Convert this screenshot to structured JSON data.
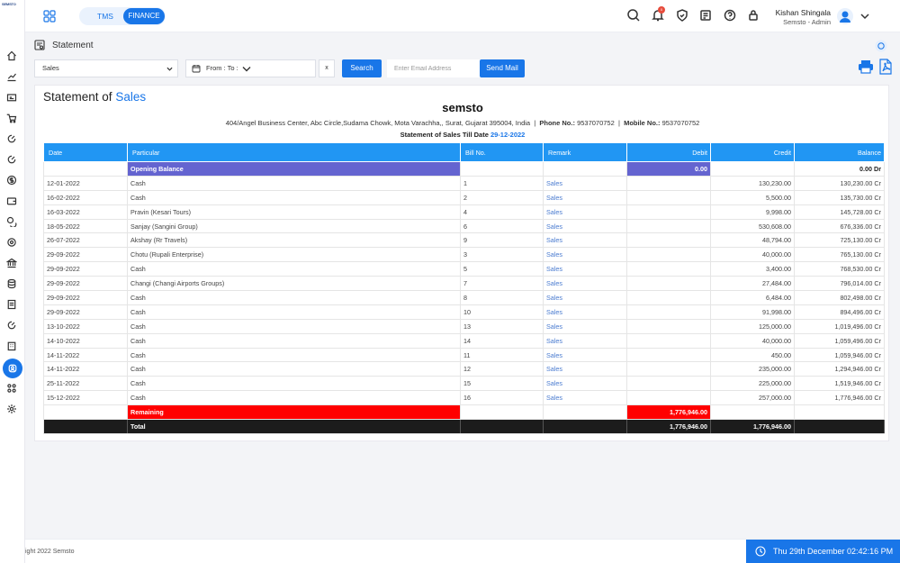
{
  "app": {
    "logo_text": "SEMSTO"
  },
  "header": {
    "tabs": [
      {
        "label": "TMS"
      },
      {
        "label": "FINANCE"
      }
    ],
    "notification_count": "0",
    "user": {
      "name": "Kishan Shingala",
      "role": "Semsto - Admin"
    }
  },
  "page": {
    "title": "Statement"
  },
  "filters": {
    "type_value": "Sales",
    "date_label": "From : To :",
    "clear_label": "x",
    "search_label": "Search",
    "email_placeholder": "Enter Email Address",
    "send_mail_label": "Send Mail"
  },
  "statement": {
    "title_prefix": "Statement of",
    "title_highlight": "Sales",
    "company": "semsto",
    "address": "404/Angel Business Center, Abc Circle,Sudama Chowk, Mota Varachha,, Surat, Gujarat 395004, India",
    "phone_label": "Phone No.:",
    "phone": "9537070752",
    "mobile_label": "Mobile No.:",
    "mobile": "9537070752",
    "till_label": "Statement of Sales Till Date",
    "till_date": "29-12-2022"
  },
  "table": {
    "headers": [
      "Date",
      "Particular",
      "Bill No.",
      "Remark",
      "Debit",
      "Credit",
      "Balance"
    ],
    "opening": {
      "label": "Opening Balance",
      "debit": "0.00",
      "balance": "0.00 Dr"
    },
    "rows": [
      {
        "date": "12-01-2022",
        "particular": "Cash",
        "bill": "1",
        "remark": "Sales",
        "credit": "130,230.00",
        "balance": "130,230.00 Cr"
      },
      {
        "date": "16-02-2022",
        "particular": "Cash",
        "bill": "2",
        "remark": "Sales",
        "credit": "5,500.00",
        "balance": "135,730.00 Cr"
      },
      {
        "date": "16-03-2022",
        "particular": "Pravin (Kesari Tours)",
        "bill": "4",
        "remark": "Sales",
        "credit": "9,998.00",
        "balance": "145,728.00 Cr"
      },
      {
        "date": "18-05-2022",
        "particular": "Sanjay (Sangini Group)",
        "bill": "6",
        "remark": "Sales",
        "credit": "530,608.00",
        "balance": "676,336.00 Cr"
      },
      {
        "date": "26-07-2022",
        "particular": "Akshay (Rr Travels)",
        "bill": "9",
        "remark": "Sales",
        "credit": "48,794.00",
        "balance": "725,130.00 Cr"
      },
      {
        "date": "29-09-2022",
        "particular": "Chotu (Rupali Enterprise)",
        "bill": "3",
        "remark": "Sales",
        "credit": "40,000.00",
        "balance": "765,130.00 Cr"
      },
      {
        "date": "29-09-2022",
        "particular": "Cash",
        "bill": "5",
        "remark": "Sales",
        "credit": "3,400.00",
        "balance": "768,530.00 Cr"
      },
      {
        "date": "29-09-2022",
        "particular": "Changi (Changi Airports Groups)",
        "bill": "7",
        "remark": "Sales",
        "credit": "27,484.00",
        "balance": "796,014.00 Cr"
      },
      {
        "date": "29-09-2022",
        "particular": "Cash",
        "bill": "8",
        "remark": "Sales",
        "credit": "6,484.00",
        "balance": "802,498.00 Cr"
      },
      {
        "date": "29-09-2022",
        "particular": "Cash",
        "bill": "10",
        "remark": "Sales",
        "credit": "91,998.00",
        "balance": "894,496.00 Cr"
      },
      {
        "date": "13-10-2022",
        "particular": "Cash",
        "bill": "13",
        "remark": "Sales",
        "credit": "125,000.00",
        "balance": "1,019,496.00 Cr"
      },
      {
        "date": "14-10-2022",
        "particular": "Cash",
        "bill": "14",
        "remark": "Sales",
        "credit": "40,000.00",
        "balance": "1,059,496.00 Cr"
      },
      {
        "date": "14-11-2022",
        "particular": "Cash",
        "bill": "11",
        "remark": "Sales",
        "credit": "450.00",
        "balance": "1,059,946.00 Cr"
      },
      {
        "date": "14-11-2022",
        "particular": "Cash",
        "bill": "12",
        "remark": "Sales",
        "credit": "235,000.00",
        "balance": "1,294,946.00 Cr"
      },
      {
        "date": "25-11-2022",
        "particular": "Cash",
        "bill": "15",
        "remark": "Sales",
        "credit": "225,000.00",
        "balance": "1,519,946.00 Cr"
      },
      {
        "date": "15-12-2022",
        "particular": "Cash",
        "bill": "16",
        "remark": "Sales",
        "credit": "257,000.00",
        "balance": "1,776,946.00 Cr"
      }
    ],
    "remaining": {
      "label": "Remaining",
      "debit": "1,776,946.00"
    },
    "total": {
      "label": "Total",
      "debit": "1,776,946.00",
      "credit": "1,776,946.00"
    }
  },
  "footer": {
    "copyright": "ight 2022 Semsto",
    "datetime": "Thu 29th December 02:42:16 PM"
  },
  "colors": {
    "accent": "#1976e8",
    "header_blue": "#2196f3",
    "opening": "#6464d0",
    "remaining": "#ff0000",
    "total": "#1c1c1c"
  }
}
